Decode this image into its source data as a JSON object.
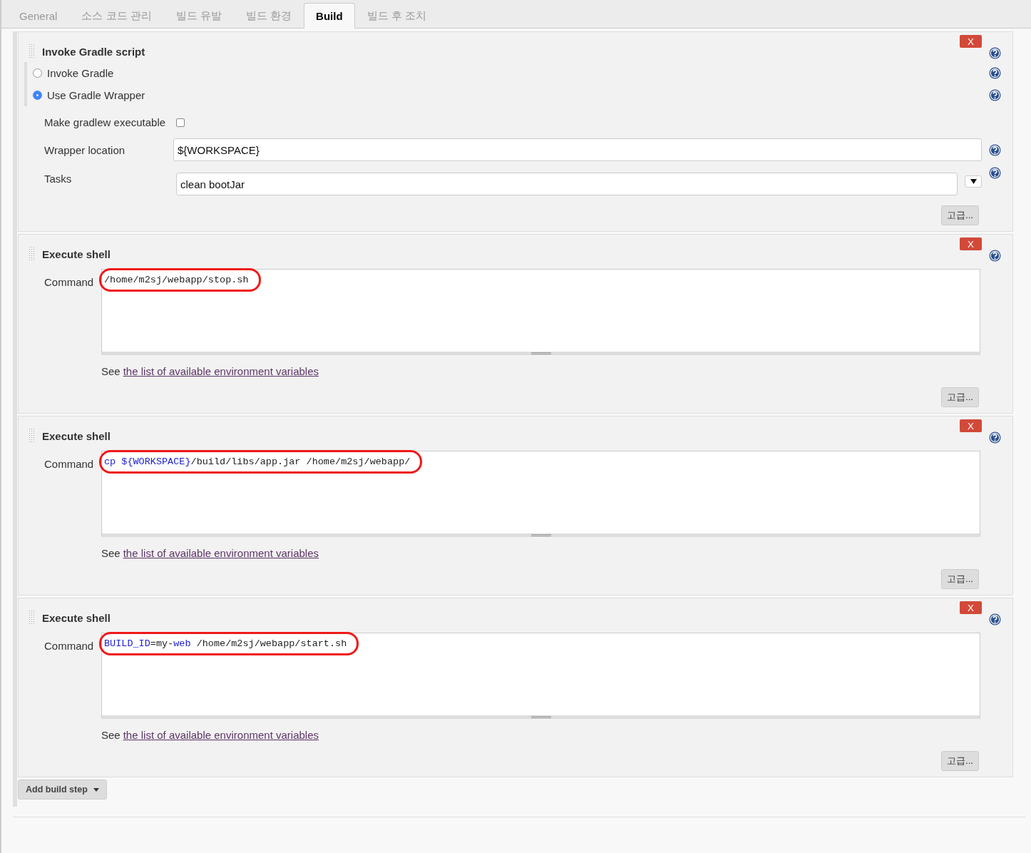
{
  "tabs": [
    {
      "label": "General",
      "selected": false
    },
    {
      "label": "소스 코드 관리",
      "selected": false
    },
    {
      "label": "빌드 유발",
      "selected": false
    },
    {
      "label": "빌드 환경",
      "selected": false
    },
    {
      "label": "Build",
      "selected": true
    },
    {
      "label": "빌드 후 조치",
      "selected": false
    }
  ],
  "steps": [
    {
      "kind": "gradle",
      "title": "Invoke Gradle script",
      "delete_label": "X",
      "options": [
        {
          "label": "Invoke Gradle",
          "selected": false
        },
        {
          "label": "Use Gradle Wrapper",
          "selected": true
        }
      ],
      "make_executable": {
        "label": "Make gradlew executable",
        "checked": false
      },
      "wrapper_location": {
        "label": "Wrapper location",
        "value": "${WORKSPACE}"
      },
      "tasks": {
        "label": "Tasks",
        "value": "clean bootJar"
      },
      "advanced_label": "고급..."
    },
    {
      "kind": "shell",
      "title": "Execute shell",
      "delete_label": "X",
      "command_label": "Command",
      "highlighted": true,
      "command": [
        {
          "text": "/home/m2sj/webapp/stop.sh",
          "kind": "plain"
        }
      ],
      "see_text": "See",
      "link": "the list of available environment variables",
      "advanced_label": "고급..."
    },
    {
      "kind": "shell",
      "title": "Execute shell",
      "delete_label": "X",
      "command_label": "Command",
      "highlighted": true,
      "command": [
        {
          "text": "cp ${WORKSPACE}",
          "kind": "variable"
        },
        {
          "text": "/build/libs/app.jar /home/m2sj/webapp/",
          "kind": "plain"
        }
      ],
      "see_text": "See",
      "link": "the list of available environment variables",
      "advanced_label": "고급..."
    },
    {
      "kind": "shell",
      "title": "Execute shell",
      "delete_label": "X",
      "command_label": "Command",
      "highlighted": true,
      "command": [
        {
          "text": "BUILD_ID",
          "kind": "variable"
        },
        {
          "text": "=my-",
          "kind": "plain"
        },
        {
          "text": "web",
          "kind": "variable"
        },
        {
          "text": " /home/m2sj/webapp/start.sh",
          "kind": "plain"
        }
      ],
      "see_text": "See",
      "link": "the list of available environment variables",
      "advanced_label": "고급..."
    }
  ],
  "add_step_label": "Add build step"
}
